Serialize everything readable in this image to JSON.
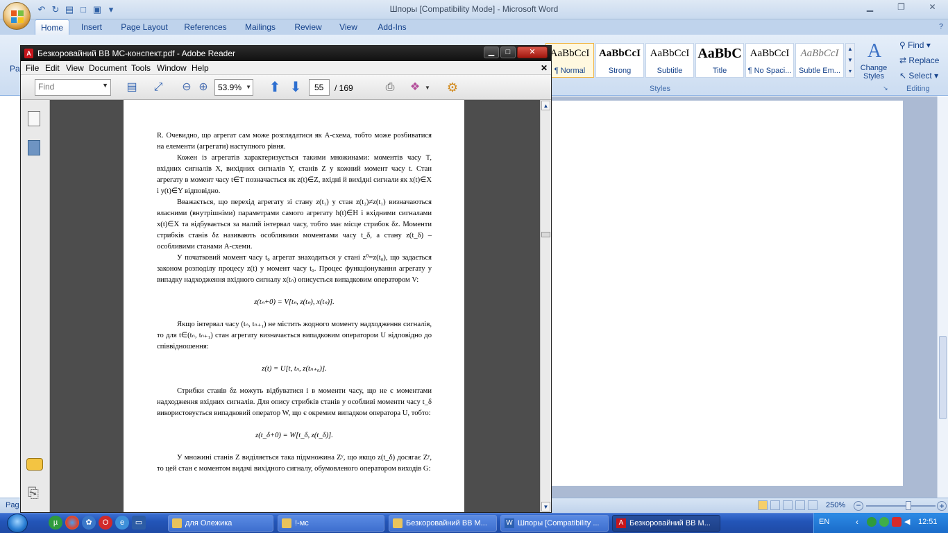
{
  "word": {
    "title": "Шпоры [Compatibility Mode] - Microsoft Word",
    "tabs": [
      "Home",
      "Insert",
      "Page Layout",
      "References",
      "Mailings",
      "Review",
      "View",
      "Add-Ins"
    ],
    "styles": [
      {
        "sample": "AaBbCcI",
        "name": "¶ Normal"
      },
      {
        "sample": "AaBbCcI",
        "name": "Strong"
      },
      {
        "sample": "AaBbCcI",
        "name": "Subtitle"
      },
      {
        "sample": "AaBbC",
        "name": "Title"
      },
      {
        "sample": "AaBbCcI",
        "name": "¶ No Spaci..."
      },
      {
        "sample": "AaBbCcI",
        "name": "Subtle Em..."
      }
    ],
    "change_styles": "Change Styles",
    "styles_group": "Styles",
    "editing": {
      "find": "Find",
      "replace": "Replace",
      "select": "Select",
      "group": "Editing"
    },
    "paste_label": "Pa",
    "status": {
      "page": "Pag",
      "zoom": "250%"
    }
  },
  "reader": {
    "title": "Безкоровайний ВВ МС-конспект.pdf - Adobe Reader",
    "menu": [
      "File",
      "Edit",
      "View",
      "Document",
      "Tools",
      "Window",
      "Help"
    ],
    "find_placeholder": "Find",
    "zoom": "53.9%",
    "page_current": "55",
    "page_total": "/ 169",
    "pdf": {
      "p1": "R. Очевидно, що агрегат сам може розглядатися як A-схема, тобто може розбиватися на елементи (агрегати) наступного рівня.",
      "p2": "Кожен із агрегатів характеризується такими множинами: моментів часу T, вхідних сигналів X, вихідних сигналів Y, станів Z у кожний момент часу t. Стан агрегату в момент часу t∈T позначається як z(t)∈Z, вхідні й вихідні сигнали як x(t)∈X і y(t)∈Y відповідно.",
      "p3": "Вважається, що перехід агрегату зі стану z(t₁) у стан z(t₂)≠z(t₁) визначаються власними (внутрішніми) параметрами самого агрегату h(t)∈H і вхідними сигналами x(t)∈X та відбувається за малий інтервал часу, тобто має місце стрибок δz. Моменти стрибків станів δz називають особливими моментами часу t_δ, а стану z(t_δ) – особливими станами A-схеми.",
      "p4": "У початковий момент часу t₀ агрегат знаходиться у стані z⁰=z(t₀), що задається законом розподілу процесу z(t) у момент часу t₀. Процес функціонування агрегату у випадку надходження вхідного сигналу x(tₙ) описується випадковим оператором V:",
      "f1": "z(tₙ+0) = V[tₙ, z(tₙ), x(tₙ)].",
      "p5": "Якщо інтервал часу (tₙ, tₙ₊₁) не містить жодного моменту надходження сигналів, то для t∈(tₙ, tₙ₊₁) стан агрегату визначається випадковим оператором U відповідно до співвідношення:",
      "f2": "z(t) = U[t, tₙ, z(tₙ₊₀)].",
      "p6": "Стрибки станів δz можуть відбуватися і в моменти часу, що не є моментами надходження вхідних сигналів. Для опису стрибків станів у особливі моменти часу t_δ використовується випадковий оператор W, що є окремим випадком оператора U, тобто:",
      "f3": "z(t_δ+0) = W[t_δ, z(t_δ)].",
      "p7": "У множині станів Z виділяється така підмножина Zʸ, що якщо z(t_δ) досягає Zʸ, то цей стан є моментом видачі вихідного сигналу, обумовленого оператором виходів G:"
    }
  },
  "taskbar": {
    "buttons": [
      {
        "label": "для Олежика",
        "active": false
      },
      {
        "label": "!-мс",
        "active": false
      },
      {
        "label": "Безкоровайний ВВ М...",
        "active": false
      },
      {
        "label": "Шпоры [Compatibility ...",
        "active": false
      },
      {
        "label": "Безкоровайний ВВ М...",
        "active": true
      }
    ],
    "lang": "EN",
    "clock": "12:51"
  },
  "colors": {
    "word_blue": "#15428b",
    "reader_title": "#1a1a1a",
    "taskbar": "#245edb"
  }
}
